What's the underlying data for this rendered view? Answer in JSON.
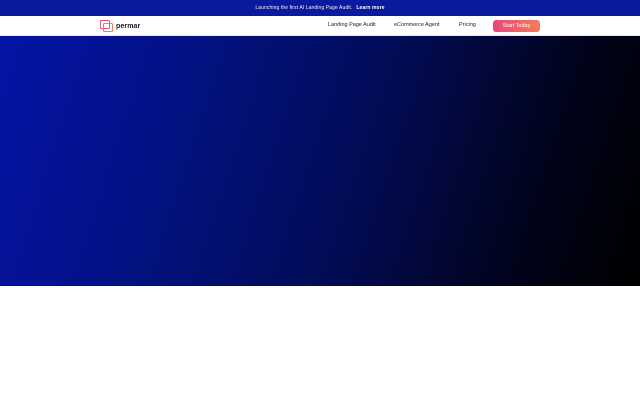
{
  "announcement": {
    "message": "Launching the first AI Landing Page Audit.",
    "link_label": "Learn more"
  },
  "header": {
    "brand": "permar",
    "nav": [
      {
        "label": "Landing Page Audit"
      },
      {
        "label": "eCommerce Agent"
      },
      {
        "label": "Pricing"
      }
    ],
    "cta_label": "Start Today"
  },
  "colors": {
    "announcement_bg": "#0a1a9e",
    "accent_gradient_start": "#e8477a",
    "accent_gradient_end": "#f27d58",
    "hero_start": "#0414a6",
    "hero_end": "#000000"
  },
  "icons": {
    "logo": "overlapping-squares-logo-icon"
  }
}
